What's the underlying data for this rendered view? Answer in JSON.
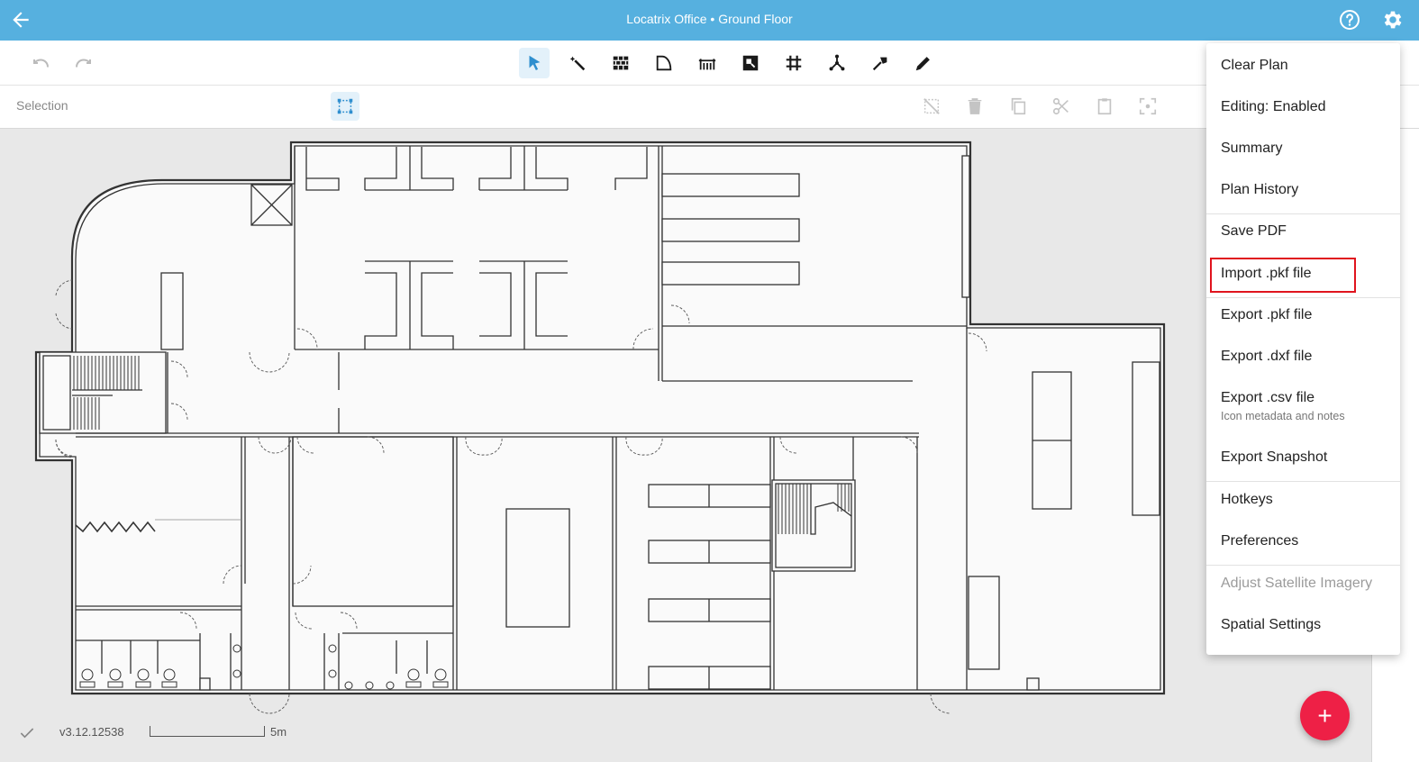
{
  "header": {
    "title": "Locatrix Office • Ground Floor"
  },
  "selection_bar": {
    "label": "Selection"
  },
  "menu": {
    "items": [
      {
        "label": "Clear Plan"
      },
      {
        "label": "Editing: Enabled"
      },
      {
        "label": "Summary"
      },
      {
        "label": "Plan History"
      },
      {
        "label": "Save PDF"
      },
      {
        "label": "Import .pkf file"
      },
      {
        "label": "Export .pkf file"
      },
      {
        "label": "Export .dxf file"
      },
      {
        "label": "Export .csv file",
        "sub": "Icon metadata and notes"
      },
      {
        "label": "Export Snapshot"
      },
      {
        "label": "Hotkeys"
      },
      {
        "label": "Preferences"
      },
      {
        "label": "Adjust Satellite Imagery",
        "disabled": true
      },
      {
        "label": "Spatial Settings"
      }
    ]
  },
  "status": {
    "version": "v3.12.12538",
    "scale_label": "5m"
  },
  "fab": {
    "label": "+"
  },
  "colors": {
    "header": "#56b0df",
    "accent": "#2f8fcf",
    "fab": "#ee2046",
    "highlight": "#e0141e"
  }
}
